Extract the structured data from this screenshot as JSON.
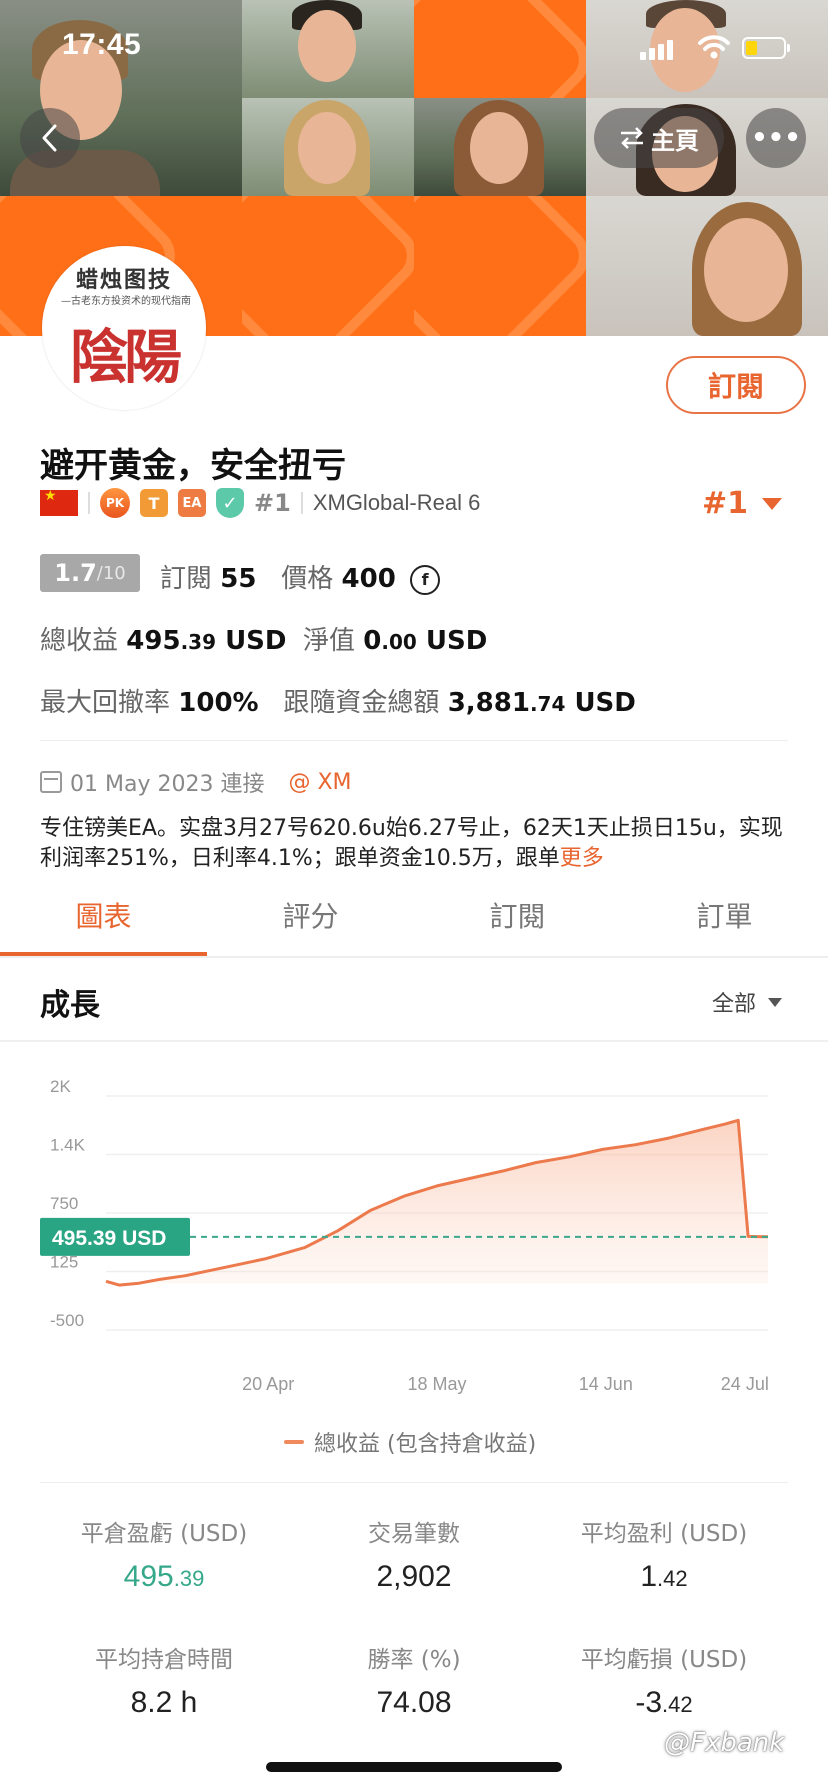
{
  "status_bar": {
    "time": "17:45"
  },
  "header": {
    "home_label": "主頁",
    "more_label": "•••"
  },
  "avatar": {
    "book_title": "蜡烛图技",
    "book_subtitle": "—古老东方投资术的现代指南",
    "seal_text": "陰陽"
  },
  "profile": {
    "title": "避开黄金，安全扭亏",
    "subscribe_label": "訂閱",
    "badges": {
      "pk": "PK",
      "t": "T",
      "ea": "EA"
    },
    "rank_small": "#1",
    "account": "XMGlobal-Real 6",
    "rank_big": "#1"
  },
  "stats": {
    "score": "1.7",
    "score_max": "/10",
    "subscribe_label": "訂閱",
    "subscribe_count": "55",
    "price_label": "價格",
    "price_value": "400",
    "coin_symbol": "f",
    "total_profit_label": "總收益",
    "total_profit_int": "495",
    "total_profit_dec": ".39",
    "unit": "USD",
    "equity_label": "淨值",
    "equity_int": "0",
    "equity_dec": ".00",
    "drawdown_label": "最大回撤率",
    "drawdown_value": "100%",
    "follow_funds_label": "跟隨資金總額",
    "follow_funds_int": "3,881",
    "follow_funds_dec": ".74"
  },
  "connection": {
    "date": "01 May 2023 連接",
    "broker": "@ XM"
  },
  "description": {
    "text": "专住镑美EA。实盘3月27号620.6u始6.27号止，62天1天止损日15u，实现利润率251%，日利率4.1%；跟单资金10.5万，跟单",
    "more": "更多"
  },
  "tabs": [
    "圖表",
    "評分",
    "訂閱",
    "訂單"
  ],
  "growth": {
    "title": "成長",
    "range": "全部"
  },
  "chart_data": {
    "type": "area",
    "ylim": [
      -500,
      2000
    ],
    "y_ticks": [
      "2K",
      "1.4K",
      "750",
      "125",
      "-500"
    ],
    "y_tick_values": [
      2000,
      1375,
      750,
      125,
      -500
    ],
    "x_ticks": [
      "20 Apr",
      "18 May",
      "14 Jun",
      "24 Jul"
    ],
    "x_tick_positions": [
      0.245,
      0.5,
      0.755,
      0.965
    ],
    "current_label": "495.39 USD",
    "current_value": 495.39,
    "series": [
      {
        "name": "總收益 (包含持倉收益)",
        "x": [
          0.0,
          0.02,
          0.05,
          0.08,
          0.12,
          0.18,
          0.24,
          0.3,
          0.35,
          0.4,
          0.45,
          0.5,
          0.55,
          0.6,
          0.65,
          0.7,
          0.75,
          0.8,
          0.85,
          0.9,
          0.935,
          0.955,
          0.97,
          1.0
        ],
        "values": [
          20,
          -20,
          0,
          40,
          80,
          170,
          260,
          380,
          560,
          780,
          930,
          1040,
          1120,
          1200,
          1290,
          1350,
          1430,
          1480,
          1550,
          1640,
          1700,
          1740,
          500,
          495.39
        ]
      }
    ],
    "legend": "總收益 (包含持倉收益)"
  },
  "metrics": [
    {
      "label": "平倉盈虧 (USD)",
      "int": "495",
      "dec": ".39",
      "highlight": true
    },
    {
      "label": "交易筆數",
      "int": "2,902",
      "dec": ""
    },
    {
      "label": "平均盈利 (USD)",
      "int": "1",
      "dec": ".42"
    },
    {
      "label": "平均持倉時間",
      "int": "8.2 h",
      "dec": ""
    },
    {
      "label": "勝率 (%)",
      "int": "74.08",
      "dec": ""
    },
    {
      "label": "平均虧損 (USD)",
      "int": "-3",
      "dec": ".42"
    }
  ],
  "watermark": "@Fxbank",
  "colors": {
    "accent": "#e8652f",
    "green": "#35a88a",
    "banner": "#ff6a13"
  }
}
